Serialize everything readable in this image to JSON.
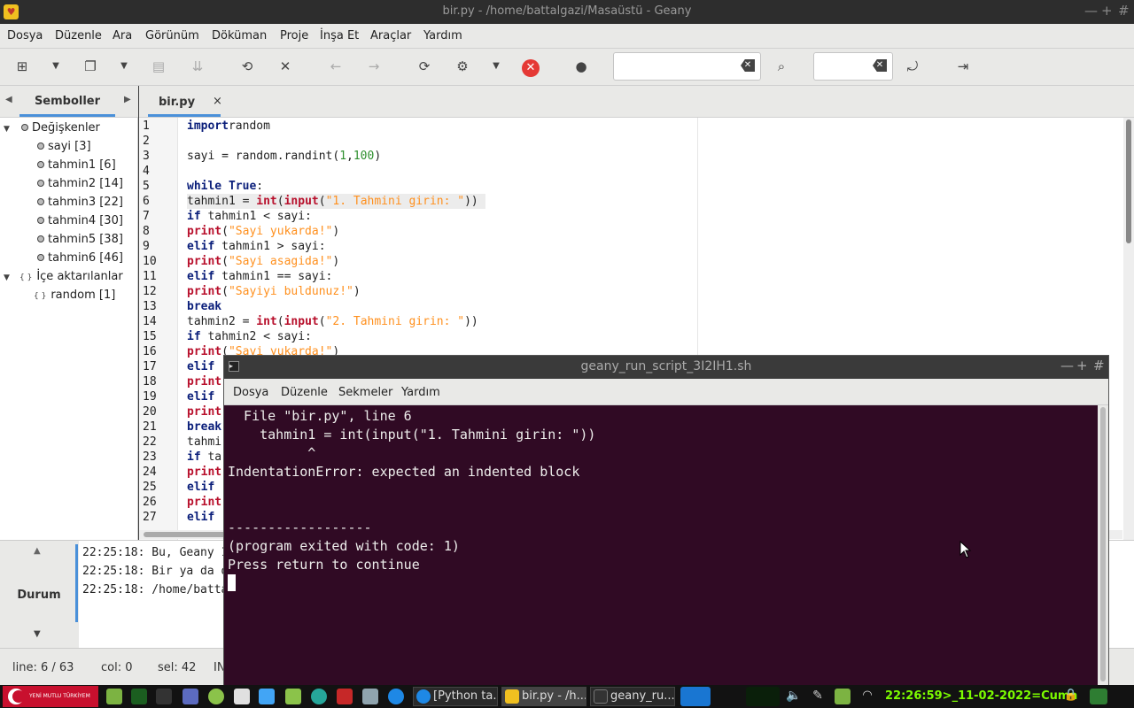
{
  "window": {
    "title": "bir.py - /home/battalgazi/Masaüstü - Geany",
    "controls": [
      "—",
      "+",
      "#"
    ]
  },
  "menu": [
    "Dosya",
    "Düzenle",
    "Ara",
    "Görünüm",
    "Döküman",
    "Proje",
    "İnşa Et",
    "Araçlar",
    "Yardım"
  ],
  "sidebar": {
    "tab": "Semboller",
    "groups": [
      {
        "label": "Değişkenler",
        "items": [
          "sayi [3]",
          "tahmin1 [6]",
          "tahmin2 [14]",
          "tahmin3 [22]",
          "tahmin4 [30]",
          "tahmin5 [38]",
          "tahmin6 [46]"
        ]
      },
      {
        "label": "İçe aktarılanlar",
        "items": [
          "random [1]"
        ]
      }
    ]
  },
  "editor": {
    "tab": "bir.py",
    "close": "×",
    "lines": [
      [
        [
          "kw",
          "import"
        ],
        [
          "",
          "random"
        ]
      ],
      [],
      [
        [
          "",
          "sayi = random.randint("
        ],
        [
          "num",
          "1"
        ],
        [
          "",
          ","
        ],
        [
          "num",
          "100"
        ],
        [
          "",
          ")"
        ]
      ],
      [],
      [
        [
          "kw",
          "while"
        ],
        [
          "",
          ""
        ],
        [
          "kw",
          " True"
        ],
        [
          "",
          ":"
        ]
      ],
      [
        [
          "",
          "tahmin1 = "
        ],
        [
          "bi",
          "int"
        ],
        [
          "",
          "("
        ],
        [
          "bi",
          "input"
        ],
        [
          "",
          "("
        ],
        [
          "str",
          "\"1. Tahmini girin: \""
        ],
        [
          "",
          "))"
        ]
      ],
      [
        [
          "kw",
          "if"
        ],
        [
          "",
          " tahmin1 < sayi:"
        ]
      ],
      [
        [
          "bi",
          "print"
        ],
        [
          "",
          "("
        ],
        [
          "str",
          "\"Sayi yukarda!\""
        ],
        [
          "",
          ")"
        ]
      ],
      [
        [
          "kw",
          "elif"
        ],
        [
          "",
          " tahmin1 > sayi:"
        ]
      ],
      [
        [
          "bi",
          "print"
        ],
        [
          "",
          "("
        ],
        [
          "str",
          "\"Sayi asagida!\""
        ],
        [
          "",
          ")"
        ]
      ],
      [
        [
          "kw",
          "elif"
        ],
        [
          "",
          " tahmin1 == sayi:"
        ]
      ],
      [
        [
          "bi",
          "print"
        ],
        [
          "",
          "("
        ],
        [
          "str",
          "\"Sayiyi buldunuz!\""
        ],
        [
          "",
          ")"
        ]
      ],
      [
        [
          "kw",
          "break"
        ]
      ],
      [
        [
          "",
          "tahmin2 = "
        ],
        [
          "bi",
          "int"
        ],
        [
          "",
          "("
        ],
        [
          "bi",
          "input"
        ],
        [
          "",
          "("
        ],
        [
          "str",
          "\"2. Tahmini girin: \""
        ],
        [
          "",
          "))"
        ]
      ],
      [
        [
          "kw",
          "if"
        ],
        [
          "",
          " tahmin2 < sayi:"
        ]
      ],
      [
        [
          "bi",
          "print"
        ],
        [
          "",
          "("
        ],
        [
          "str",
          "\"Sayi yukarda!\""
        ],
        [
          "",
          ")"
        ]
      ],
      [
        [
          "kw",
          "elif"
        ]
      ],
      [
        [
          "bi",
          "print"
        ]
      ],
      [
        [
          "kw",
          "elif"
        ]
      ],
      [
        [
          "bi",
          "print"
        ]
      ],
      [
        [
          "kw",
          "break"
        ]
      ],
      [
        [
          "",
          "tahmi"
        ]
      ],
      [
        [
          "kw",
          "if"
        ],
        [
          "",
          " ta"
        ]
      ],
      [
        [
          "bi",
          "print"
        ]
      ],
      [
        [
          "kw",
          "elif"
        ]
      ],
      [
        [
          "bi",
          "print"
        ]
      ],
      [
        [
          "kw",
          "elif"
        ]
      ]
    ],
    "line_numbers": [
      "1",
      "2",
      "3",
      "4",
      "5",
      "6",
      "7",
      "8",
      "9",
      "10",
      "11",
      "12",
      "13",
      "14",
      "15",
      "16",
      "17",
      "18",
      "19",
      "20",
      "21",
      "22",
      "23",
      "24",
      "25",
      "26",
      "27"
    ]
  },
  "messages": {
    "label": "Durum",
    "lines": [
      "22:25:18: Bu, Geany 1.3",
      "22:25:18: Bir ya da dah",
      "22:25:18: /home/battalg"
    ]
  },
  "status": {
    "line": "line: 6 / 63",
    "col": "col: 0",
    "sel": "sel: 42",
    "ins": "IN"
  },
  "terminal": {
    "title": "geany_run_script_3I2IH1.sh",
    "menu": [
      "Dosya",
      "Düzenle",
      "Sekmeler",
      "Yardım"
    ],
    "lines": [
      "  File \"bir.py\", line 6",
      "    tahmin1 = int(input(\"1. Tahmini girin: \"))",
      "          ^",
      "IndentationError: expected an indented block",
      "",
      "",
      "------------------",
      "(program exited with code: 1)",
      "Press return to continue"
    ]
  },
  "taskbar": {
    "start_text": "YENİ MUTLU TÜRKİYEM DİYENE",
    "tasks": [
      "[Python ta...",
      "bir.py - /h...",
      "geany_ru..."
    ],
    "clock": "22:26:59>_11-02-2022=Cuma"
  },
  "colors": {
    "terminal_bg": "#300a24",
    "accent": "#4a90d9",
    "stop_red": "#e53935",
    "clock": "#7cfc00"
  }
}
